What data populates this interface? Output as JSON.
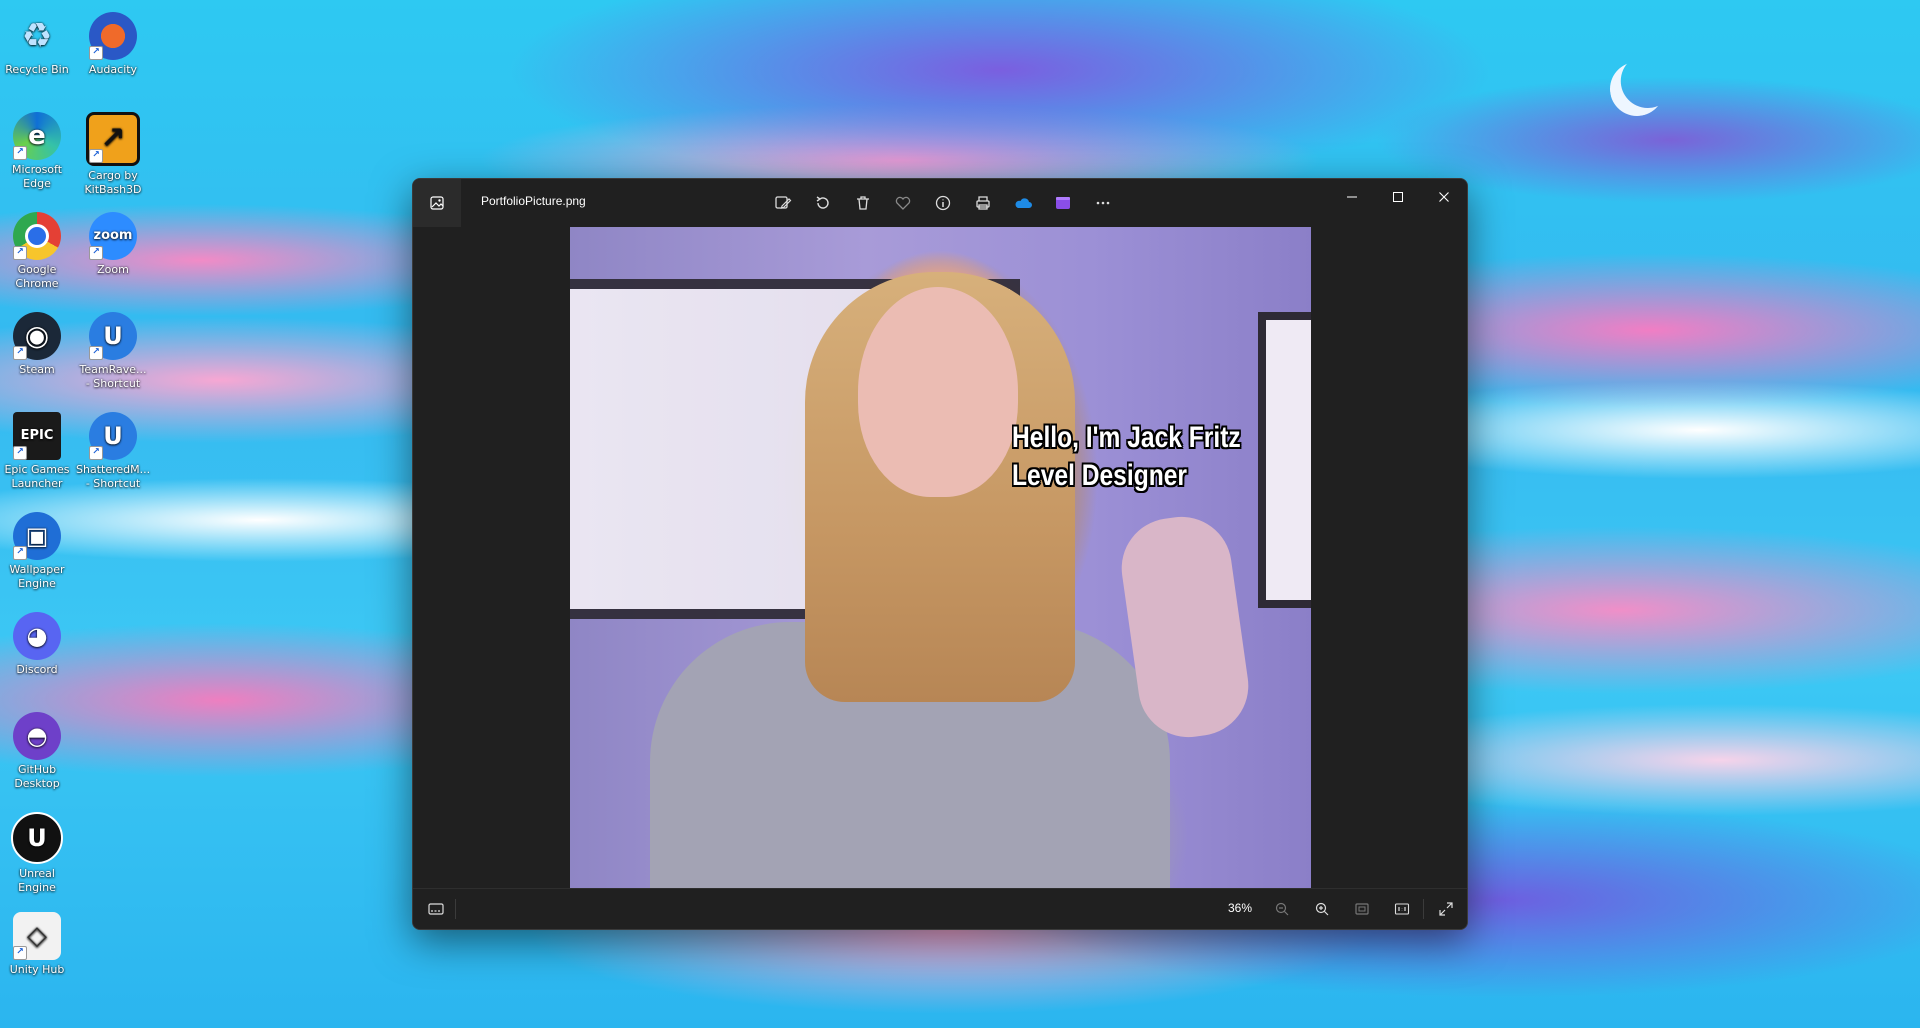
{
  "desktop": {
    "icons": [
      {
        "label": "Recycle Bin",
        "glyph": "♻",
        "color": "#6fb4e8"
      },
      {
        "label": "Audacity",
        "glyph": "🎧",
        "color": "#2a58c6"
      },
      {
        "label": "Microsoft Edge",
        "glyph": "e",
        "color": "#1b9de2"
      },
      {
        "label": "Cargo by KitBash3D",
        "glyph": "↗",
        "color": "#f0a11b"
      },
      {
        "label": "Google Chrome",
        "glyph": "●",
        "color": "#e44035"
      },
      {
        "label": "Zoom",
        "glyph": "zoom",
        "color": "#2d8cff"
      },
      {
        "label": "Steam",
        "glyph": "◉",
        "color": "#1b2838"
      },
      {
        "label": "TeamRave... - Shortcut",
        "glyph": "U",
        "color": "#2a7de1"
      },
      {
        "label": "Epic Games Launcher",
        "glyph": "EPIC",
        "color": "#1a1a1a"
      },
      {
        "label": "ShatteredM... - Shortcut",
        "glyph": "U",
        "color": "#2a7de1"
      },
      {
        "label": "Wallpaper Engine",
        "glyph": "▣",
        "color": "#1f6ed6"
      },
      {
        "label": "Discord",
        "glyph": "◕",
        "color": "#5865f2"
      },
      {
        "label": "GitHub Desktop",
        "glyph": "◓",
        "color": "#6e40c9"
      },
      {
        "label": "Unreal Engine",
        "glyph": "U",
        "color": "#111111"
      },
      {
        "label": "Unity Hub",
        "glyph": "◇",
        "color": "#f2f2f2"
      }
    ]
  },
  "window": {
    "filename": "PortfolioPicture.png",
    "caption_line1": "Hello, I'm Jack Fritz",
    "caption_line2": "Level Designer",
    "zoom": "36%"
  }
}
